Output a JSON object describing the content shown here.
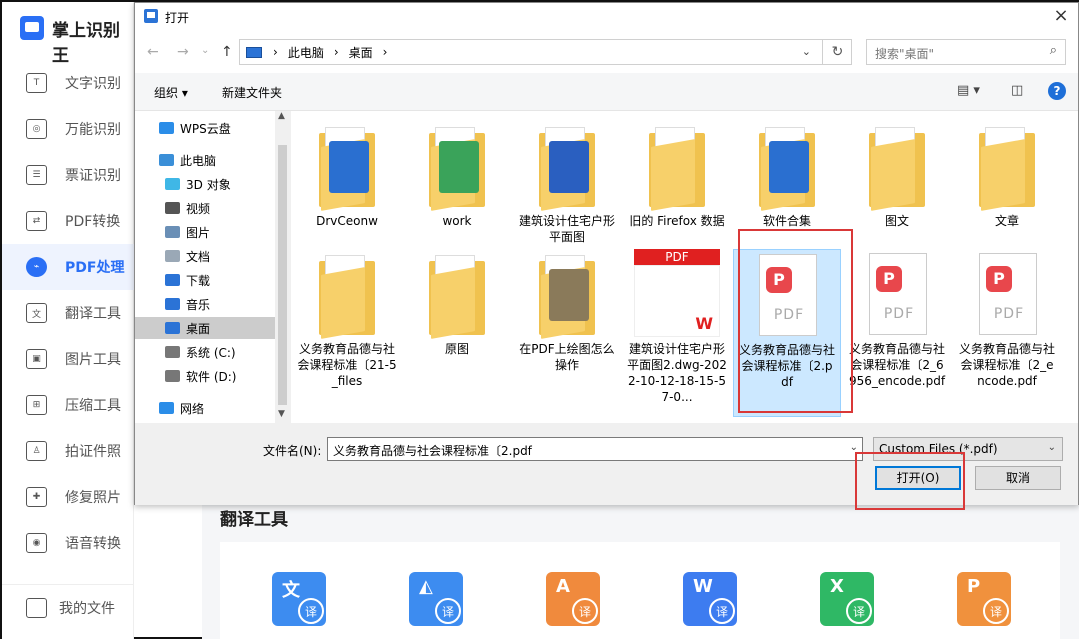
{
  "app": {
    "name": "掌上识别王",
    "nav": [
      {
        "label": "文字识别",
        "icon": "text-recognition-icon",
        "glyph": "T"
      },
      {
        "label": "万能识别",
        "icon": "universal-recognition-icon",
        "glyph": "◎"
      },
      {
        "label": "票证识别",
        "icon": "ticket-recognition-icon",
        "glyph": "☰"
      },
      {
        "label": "PDF转换",
        "icon": "pdf-convert-icon",
        "glyph": "⇄"
      },
      {
        "label": "PDF处理",
        "icon": "pdf-process-icon",
        "glyph": "⌁"
      },
      {
        "label": "翻译工具",
        "icon": "translate-tool-icon",
        "glyph": "文"
      },
      {
        "label": "图片工具",
        "icon": "image-tool-icon",
        "glyph": "▣"
      },
      {
        "label": "压缩工具",
        "icon": "compress-tool-icon",
        "glyph": "⊞"
      },
      {
        "label": "拍证件照",
        "icon": "id-photo-icon",
        "glyph": "♙"
      },
      {
        "label": "修复照片",
        "icon": "repair-photo-icon",
        "glyph": "✚"
      },
      {
        "label": "语音转换",
        "icon": "voice-convert-icon",
        "glyph": "◉"
      }
    ],
    "active_nav": "PDF处理",
    "my_files": "我的文件",
    "section_title": "翻译工具",
    "tools": [
      {
        "icon": "text-translate-icon",
        "sym": "文",
        "badge": "译",
        "color": "#3d8cf0"
      },
      {
        "icon": "image-translate-icon",
        "sym": "◭",
        "badge": "译",
        "color": "#3d8cf0"
      },
      {
        "icon": "pdf-translate-icon",
        "sym": "A",
        "badge": "译",
        "color": "#f08a3d"
      },
      {
        "icon": "word-translate-icon",
        "sym": "W",
        "badge": "译",
        "color": "#3d7cf0"
      },
      {
        "icon": "excel-translate-icon",
        "sym": "X",
        "badge": "译",
        "color": "#2fb865"
      },
      {
        "icon": "ppt-translate-icon",
        "sym": "P",
        "badge": "译",
        "color": "#f0913d"
      }
    ]
  },
  "dialog": {
    "title": "打开",
    "close": "×",
    "nav": {
      "back": "←",
      "forward": "→",
      "recent": "⌄",
      "up": "↑"
    },
    "address": {
      "crumbs": [
        "此电脑",
        "桌面"
      ],
      "sep": "›",
      "dropdown": "⌄",
      "refresh": "↻"
    },
    "search_placeholder": "搜索\"桌面\"",
    "toolbar": {
      "organize": "组织 ▾",
      "new_folder": "新建文件夹",
      "view": "▤ ▾",
      "pane": "◫",
      "help": "?"
    },
    "tree": [
      {
        "label": "WPS云盘",
        "icon": "cloud-icon",
        "color": "#2b8de8",
        "indent": 0
      },
      {
        "label": "此电脑",
        "icon": "computer-icon",
        "color": "#3a8fd8",
        "indent": 0
      },
      {
        "label": "3D 对象",
        "icon": "3d-objects-icon",
        "color": "#3fb7e6",
        "indent": 1
      },
      {
        "label": "视频",
        "icon": "video-icon",
        "color": "#555555",
        "indent": 1
      },
      {
        "label": "图片",
        "icon": "pictures-icon",
        "color": "#6a8fb6",
        "indent": 1
      },
      {
        "label": "文档",
        "icon": "documents-icon",
        "color": "#9aa8b6",
        "indent": 1
      },
      {
        "label": "下载",
        "icon": "downloads-icon",
        "color": "#2b73d6",
        "indent": 1
      },
      {
        "label": "音乐",
        "icon": "music-icon",
        "color": "#2b73d6",
        "indent": 1
      },
      {
        "label": "桌面",
        "icon": "desktop-icon",
        "color": "#2b73d6",
        "indent": 1,
        "selected": true
      },
      {
        "label": "系统 (C:)",
        "icon": "drive-c-icon",
        "color": "#777777",
        "indent": 1
      },
      {
        "label": "软件 (D:)",
        "icon": "drive-d-icon",
        "color": "#777777",
        "indent": 1
      },
      {
        "label": "网络",
        "icon": "network-icon",
        "color": "#2b8de8",
        "indent": 0
      }
    ],
    "files": [
      {
        "name": "DrvCeonw",
        "kind": "folder",
        "overlay": "#2a6fd0"
      },
      {
        "name": "work",
        "kind": "folder",
        "overlay": "#3aa35a"
      },
      {
        "name": "建筑设计住宅户形平面图",
        "kind": "folder",
        "overlay": "#2a5fc0"
      },
      {
        "name": "旧的 Firefox 数据",
        "kind": "folder",
        "overlay": ""
      },
      {
        "name": "软件合集",
        "kind": "folder",
        "overlay": "#2a6fd0"
      },
      {
        "name": "图文",
        "kind": "folder",
        "overlay": ""
      },
      {
        "name": "文章",
        "kind": "folder",
        "overlay": ""
      },
      {
        "name": "义务教育品德与社会课程标准〔21-5_files",
        "kind": "folder",
        "overlay": ""
      },
      {
        "name": "原图",
        "kind": "folder",
        "overlay": ""
      },
      {
        "name": "在PDF上绘图怎么操作",
        "kind": "folder",
        "overlay": "#8a7a5a"
      },
      {
        "name": "建筑设计住宅户形平面图2.dwg-2022-10-12-18-15-57-0...",
        "kind": "wps-pdf",
        "banner": "PDF"
      },
      {
        "name": "义务教育品德与社会课程标准〔2.pdf",
        "kind": "pdf",
        "selected": true
      },
      {
        "name": "义务教育品德与社会课程标准〔2_6956_encode.pdf",
        "kind": "pdf"
      },
      {
        "name": "义务教育品德与社会课程标准〔2_encode.pdf",
        "kind": "pdf"
      }
    ],
    "filename_label": "文件名(N):",
    "filename_value": "义务教育品德与社会课程标准〔2.pdf",
    "filetype": "Custom Files (*.pdf)",
    "open_button": "打开(O)",
    "cancel_button": "取消",
    "pdf_badge_text": "PDF"
  }
}
